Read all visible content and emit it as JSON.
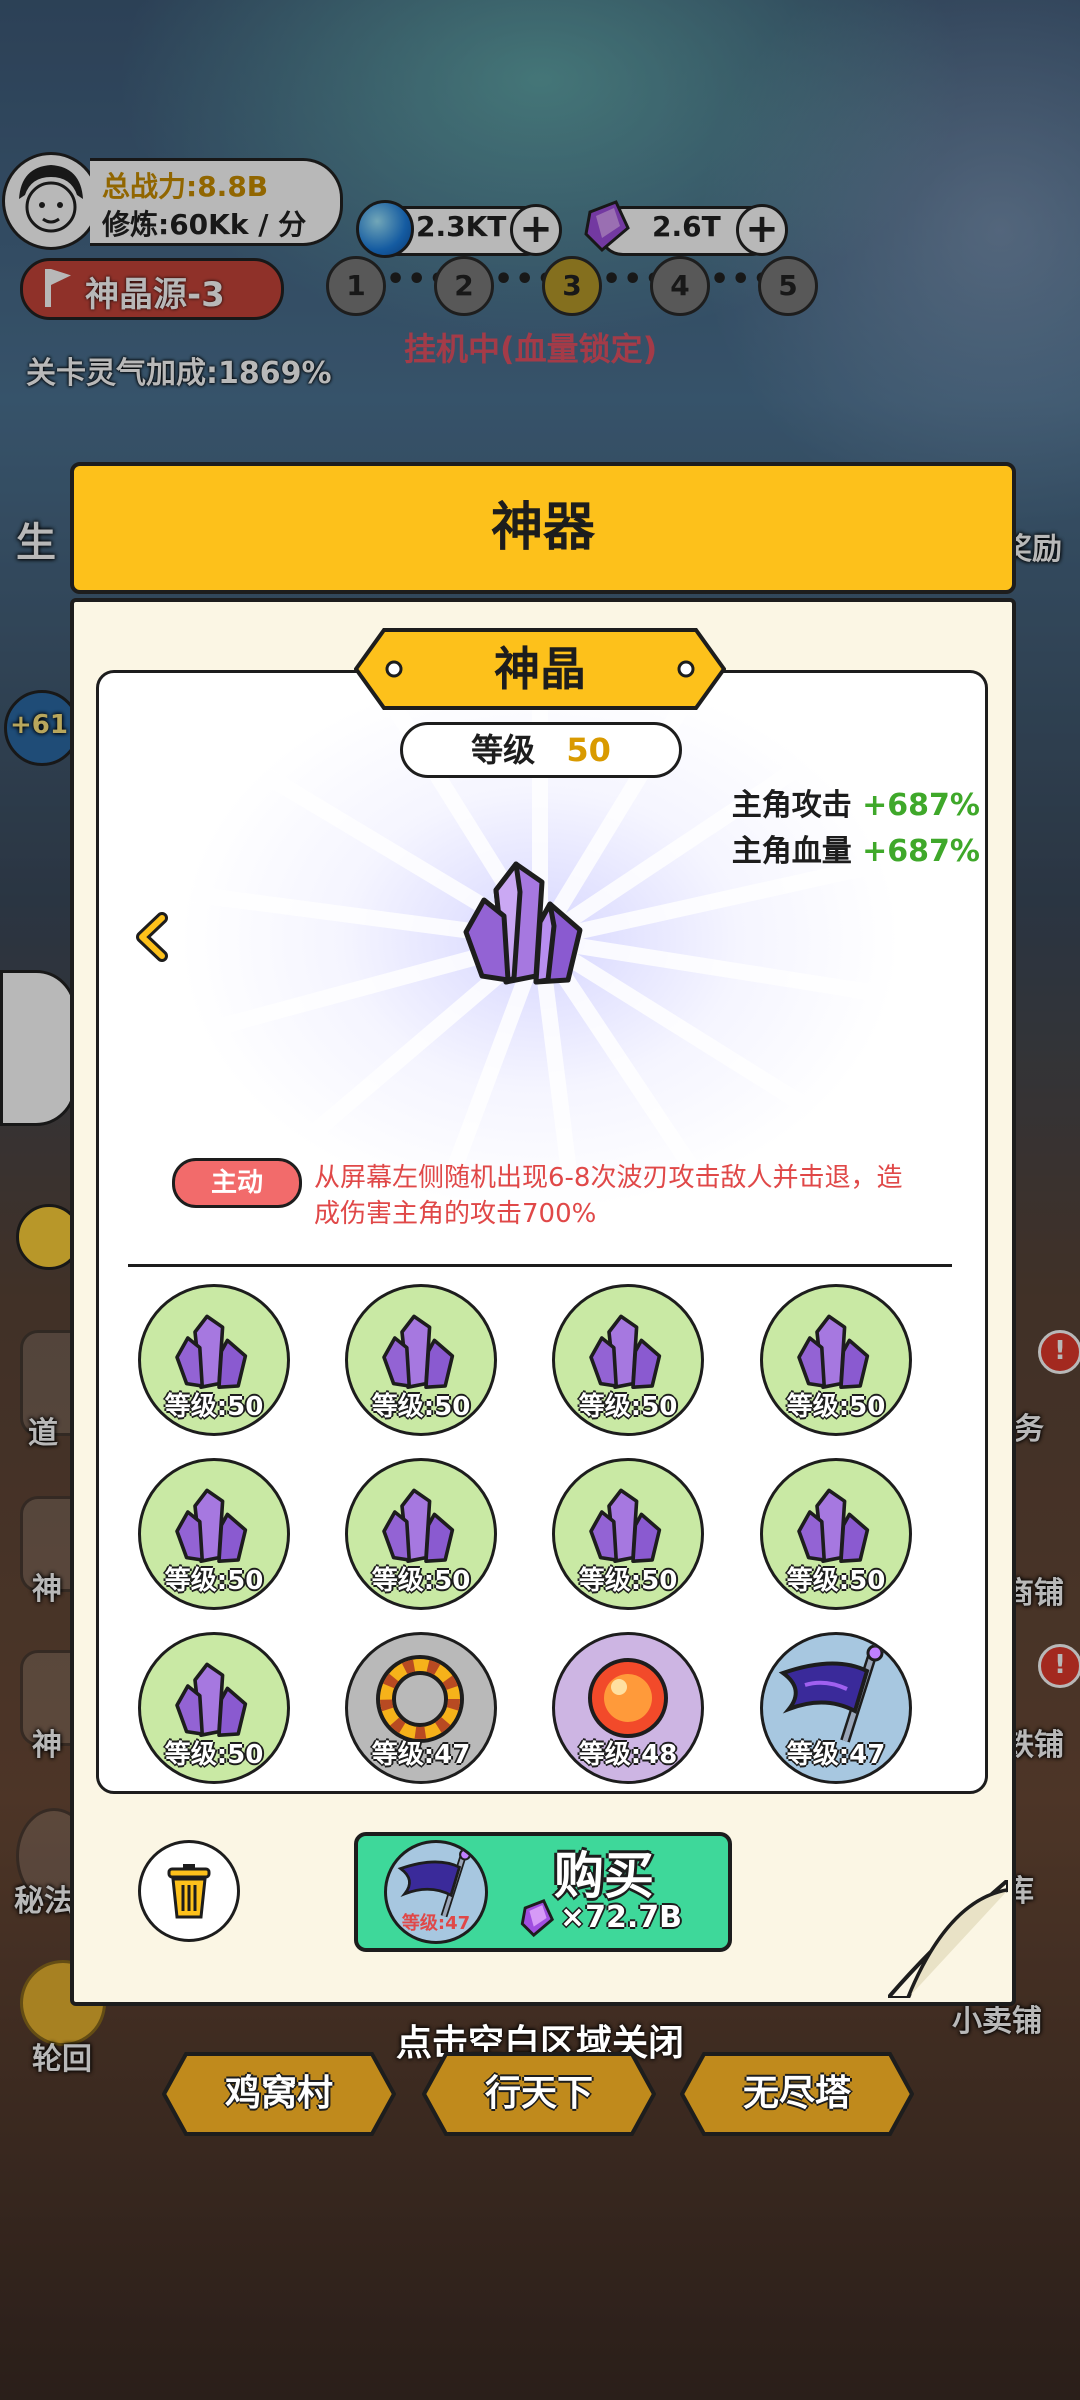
{
  "hud": {
    "power_label": "总战力:8.8B",
    "cultivation_label": "修炼:60Kk / 分",
    "currency_blue": "2.3KT",
    "currency_purple": "2.6T",
    "stage_name": "神晶源-3",
    "stages": [
      "1",
      "2",
      "3",
      "4",
      "5"
    ],
    "active_stage": "3",
    "status_text": "挂机中(血量锁定)",
    "aura_bonus": "关卡灵气加成:1869%"
  },
  "modal": {
    "title": "神器",
    "item_name": "神晶",
    "level_label": "等级",
    "level_value": "50",
    "stats": [
      {
        "label": "主角攻击",
        "value": "+687%"
      },
      {
        "label": "主角血量",
        "value": "+687%"
      }
    ],
    "skill_tag": "主动",
    "skill_desc": "从屏幕左侧随机出现6-8次波刃攻击敌人并击退，造成伤害主角的攻击700%",
    "slots": [
      {
        "icon": "crystal-icon",
        "level": "等级:50"
      },
      {
        "icon": "crystal-icon",
        "level": "等级:50"
      },
      {
        "icon": "crystal-icon",
        "level": "等级:50"
      },
      {
        "icon": "crystal-icon",
        "level": "等级:50"
      },
      {
        "icon": "crystal-icon",
        "level": "等级:50"
      },
      {
        "icon": "crystal-icon",
        "level": "等级:50"
      },
      {
        "icon": "crystal-icon",
        "level": "等级:50"
      },
      {
        "icon": "crystal-icon",
        "level": "等级:50"
      },
      {
        "icon": "crystal-icon",
        "level": "等级:50"
      },
      {
        "icon": "ring-icon",
        "level": "等级:47"
      },
      {
        "icon": "orb-icon",
        "level": "等级:48"
      },
      {
        "icon": "flag-icon",
        "level": "等级:47"
      }
    ],
    "buy": {
      "label": "购买",
      "item_level": "等级:47",
      "cost": "×72.7B"
    },
    "close_hint": "点击空白区域关闭"
  },
  "side": {
    "left_partial": [
      "生",
      "+61",
      "道",
      "神",
      "神",
      "秘法",
      "轮回"
    ],
    "right_partial": [
      "奖励",
      "务",
      "商铺",
      "铁铺",
      "库",
      "小卖铺"
    ]
  },
  "nav": [
    "鸡窝村",
    "行天下",
    "无尽塔"
  ],
  "colors": {
    "header": "#fdc11b",
    "panel": "#fbf6e4",
    "buy": "#3ed89a",
    "stat_value": "#3fa82a",
    "skill": "#e04848"
  }
}
